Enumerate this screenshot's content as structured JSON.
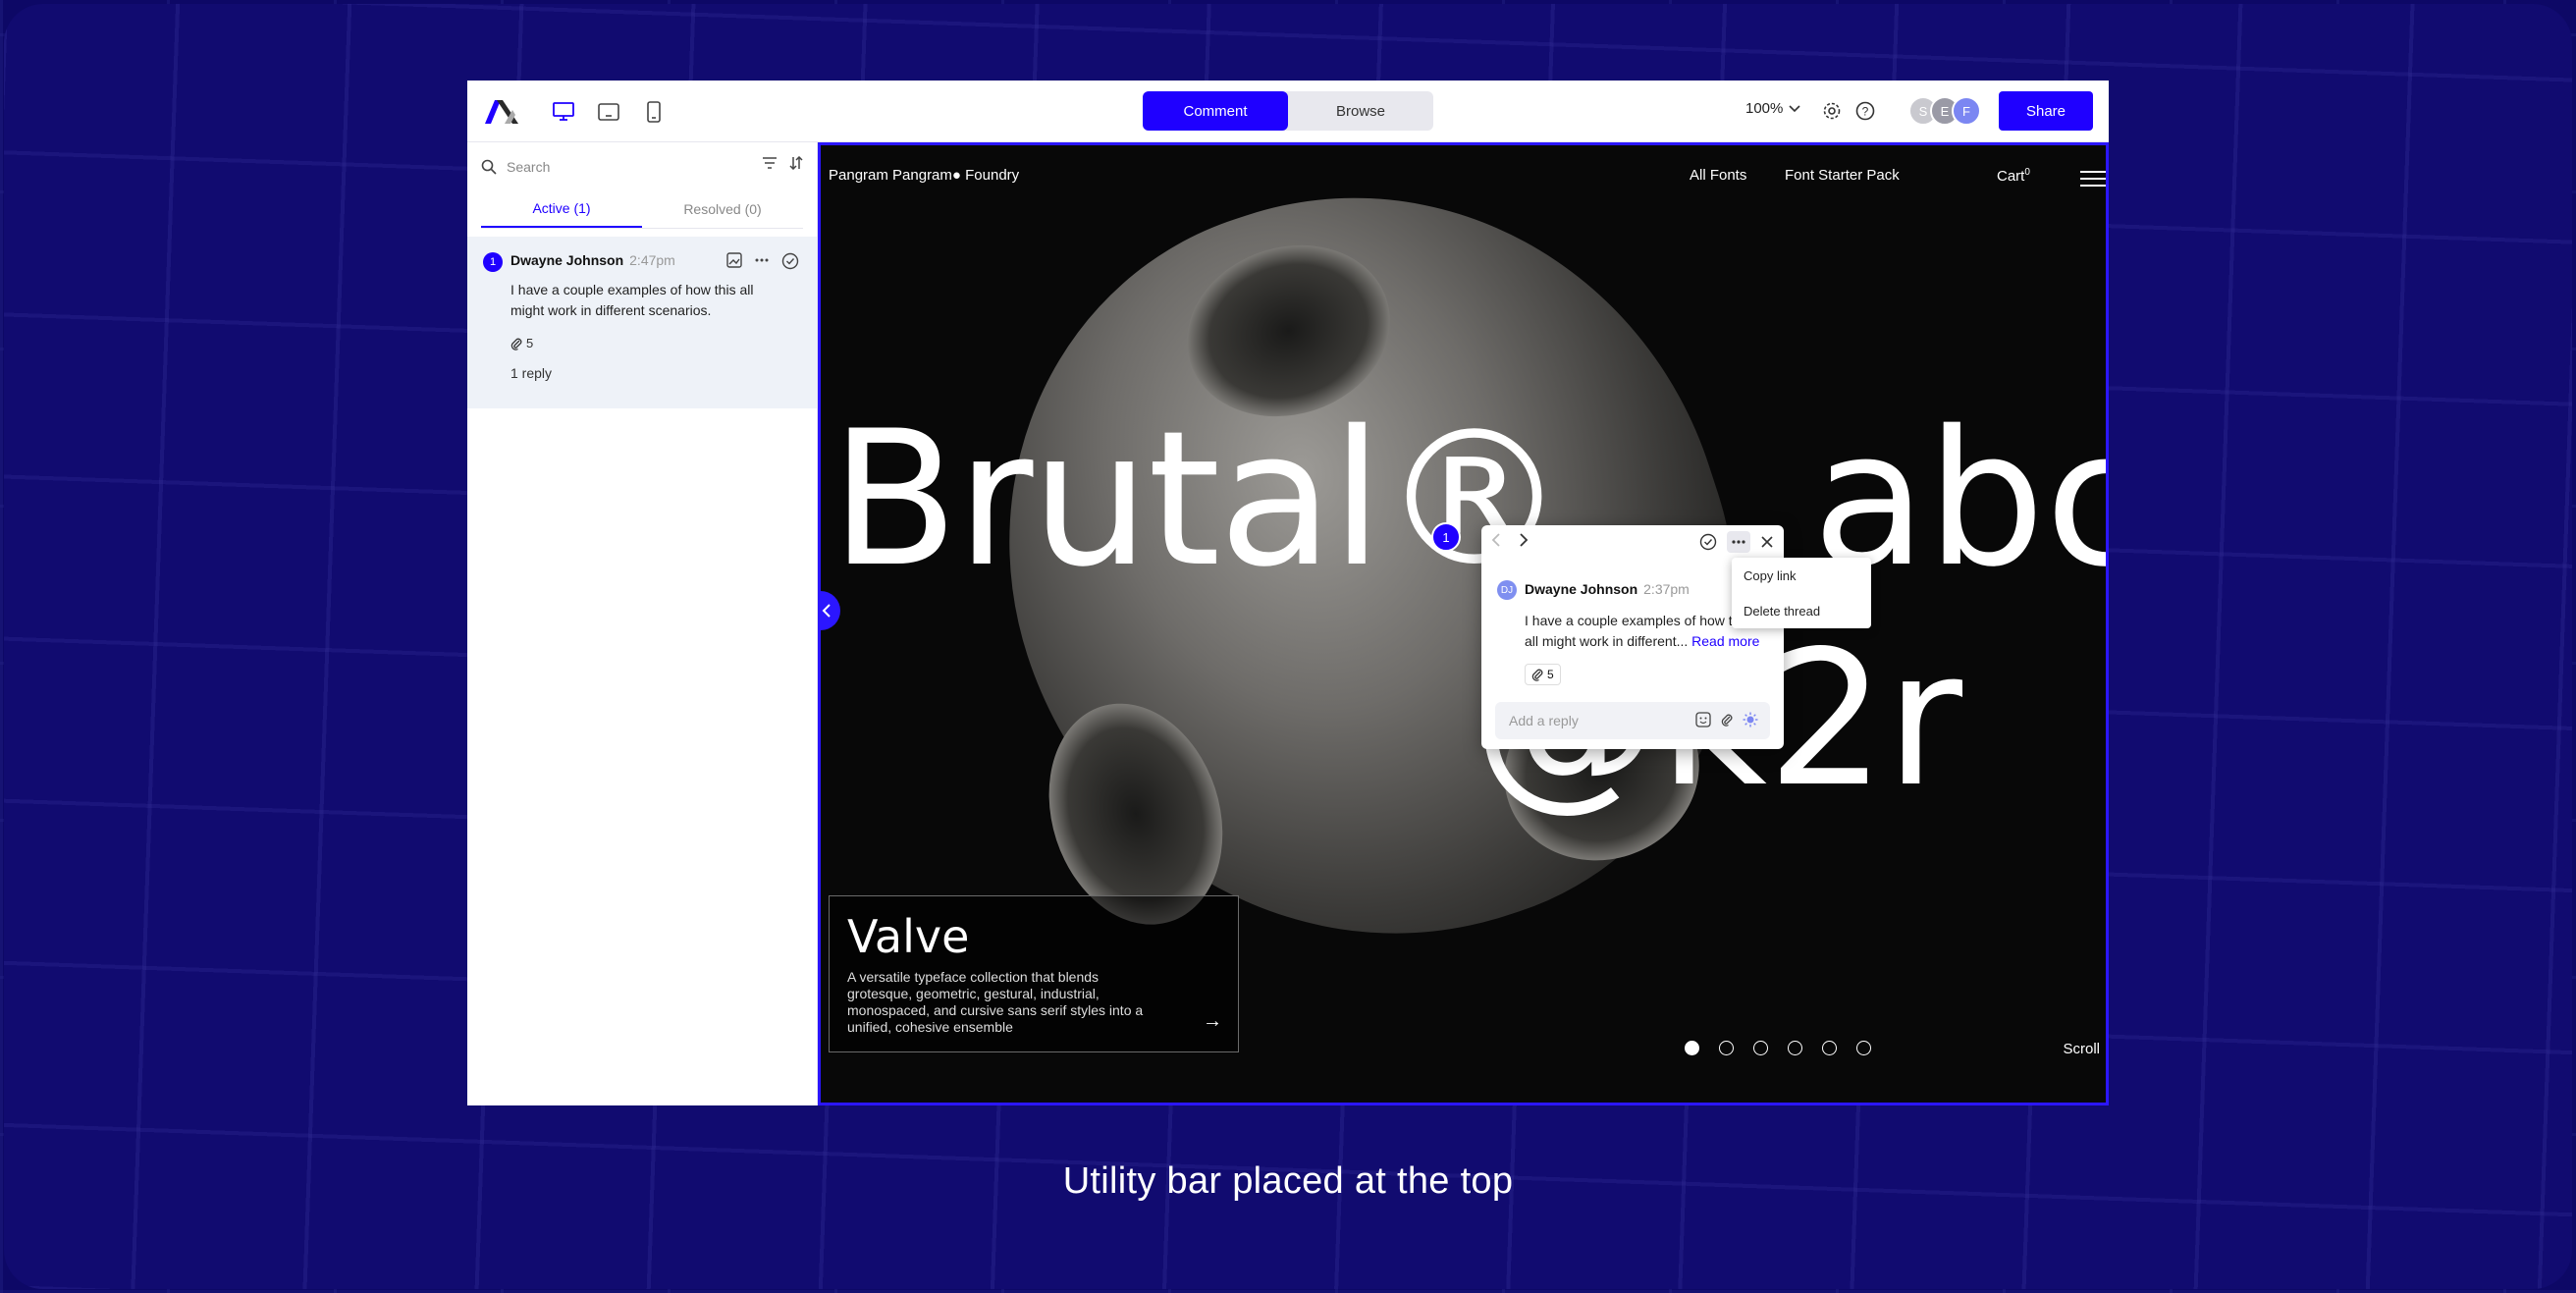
{
  "toolbar": {
    "mode_comment": "Comment",
    "mode_browse": "Browse",
    "zoom": "100%",
    "avatars": [
      "S",
      "E",
      "F"
    ],
    "share": "Share"
  },
  "sidebar": {
    "search_placeholder": "Search",
    "tabs": [
      {
        "label": "Active (1)"
      },
      {
        "label": "Resolved (0)"
      }
    ],
    "thread": {
      "number": "1",
      "author": "Dwayne Johnson",
      "time": "2:47pm",
      "body": "I have a couple examples of how this all might work in different scenarios.",
      "attachments": "5",
      "replies": "1 reply"
    }
  },
  "site": {
    "logo": "Pangram Pangram● Foundry",
    "nav": [
      "All Fonts",
      "Font Starter Pack"
    ],
    "cart": "Cart",
    "cart_count": "0",
    "hero_line1": "Brutal®",
    "hero_line1b": "abc",
    "hero_line2": "@k2r",
    "card_title": "Valve",
    "card_desc": "A versatile typeface collection that blends grotesque, geometric, gestural, industrial, monospaced, and cursive sans serif styles into a unified, cohesive ensemble",
    "scroll": "Scroll",
    "carousel_total": 6,
    "carousel_active": 1
  },
  "popup": {
    "pin_number": "1",
    "avatar": "DJ",
    "author": "Dwayne Johnson",
    "time": "2:37pm",
    "body": "I have a couple examples of how this all might work in different...",
    "read_more": "Read more",
    "attachments": "5",
    "reply_placeholder": "Add a reply",
    "menu": [
      "Copy link",
      "Delete thread"
    ]
  },
  "caption": "Utility bar placed at the top",
  "colors": {
    "accent": "#1f00ff",
    "background": "#110b70"
  }
}
